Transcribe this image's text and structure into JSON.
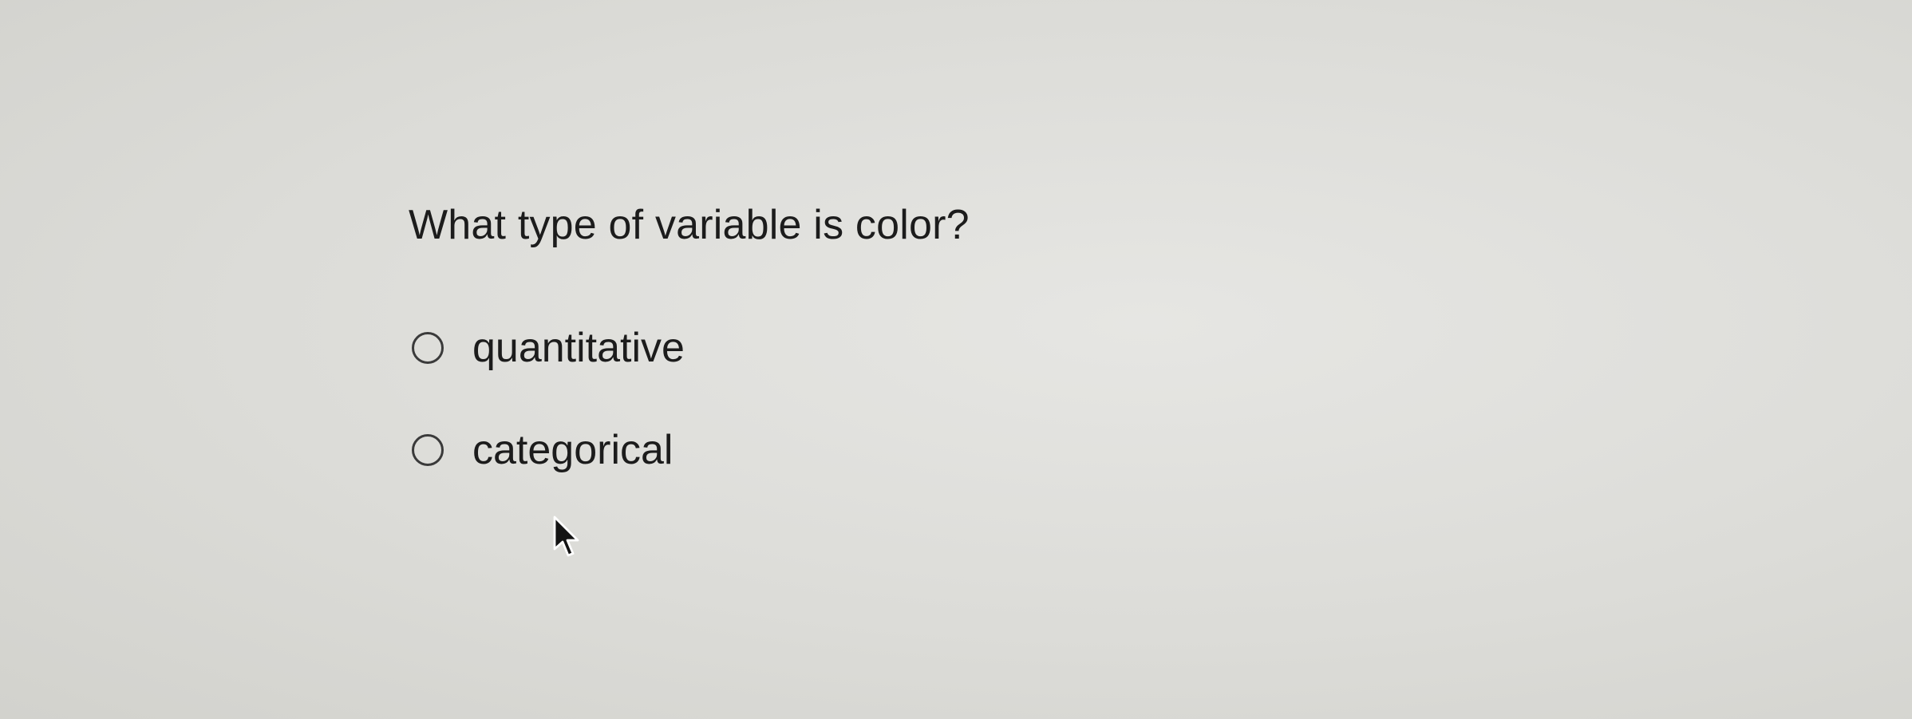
{
  "question": {
    "text": "What type of variable is color?"
  },
  "options": [
    {
      "label": "quantitative",
      "selected": false
    },
    {
      "label": "categorical",
      "selected": false
    }
  ],
  "cursor": {
    "icon": "mouse-pointer-icon"
  }
}
